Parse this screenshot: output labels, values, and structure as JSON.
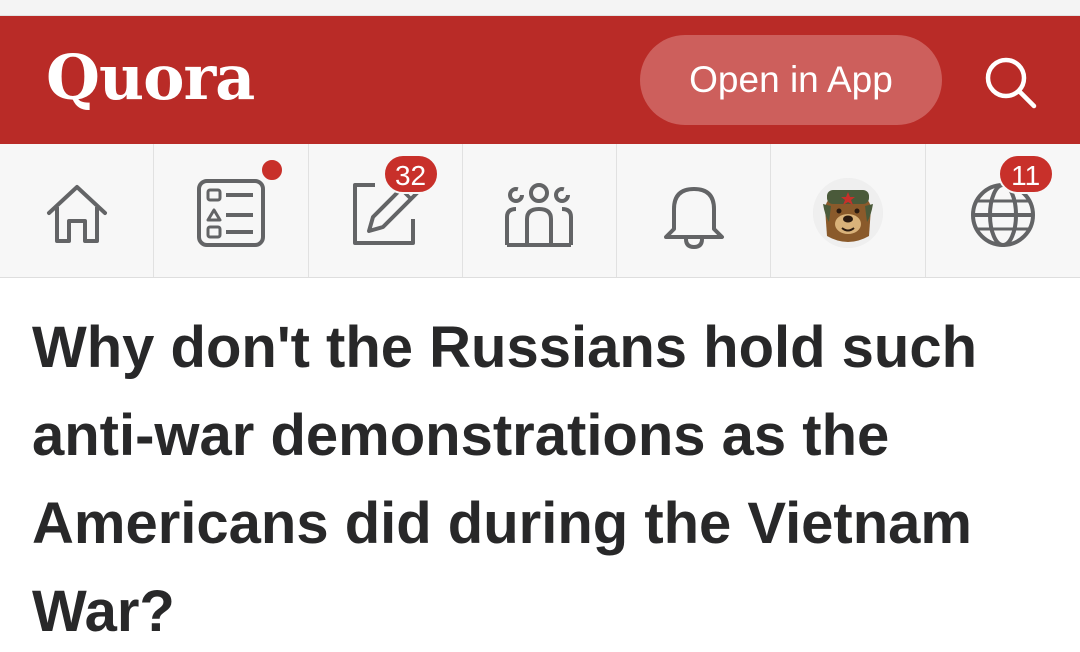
{
  "header": {
    "logo": "Quora",
    "open_app_label": "Open in App",
    "brand_color": "#b92b27"
  },
  "nav": {
    "items": [
      {
        "name": "home",
        "icon": "home-icon"
      },
      {
        "name": "following",
        "icon": "list-icon",
        "has_dot": true
      },
      {
        "name": "answer",
        "icon": "edit-icon",
        "badge": "32"
      },
      {
        "name": "spaces",
        "icon": "people-icon"
      },
      {
        "name": "notifications",
        "icon": "bell-icon"
      },
      {
        "name": "profile",
        "icon": "bear-avatar"
      },
      {
        "name": "languages",
        "icon": "globe-icon",
        "badge": "11"
      }
    ]
  },
  "question": {
    "title": "Why don't the Russians hold such anti-war demonstrations as the Americans did during the Vietnam War?"
  }
}
